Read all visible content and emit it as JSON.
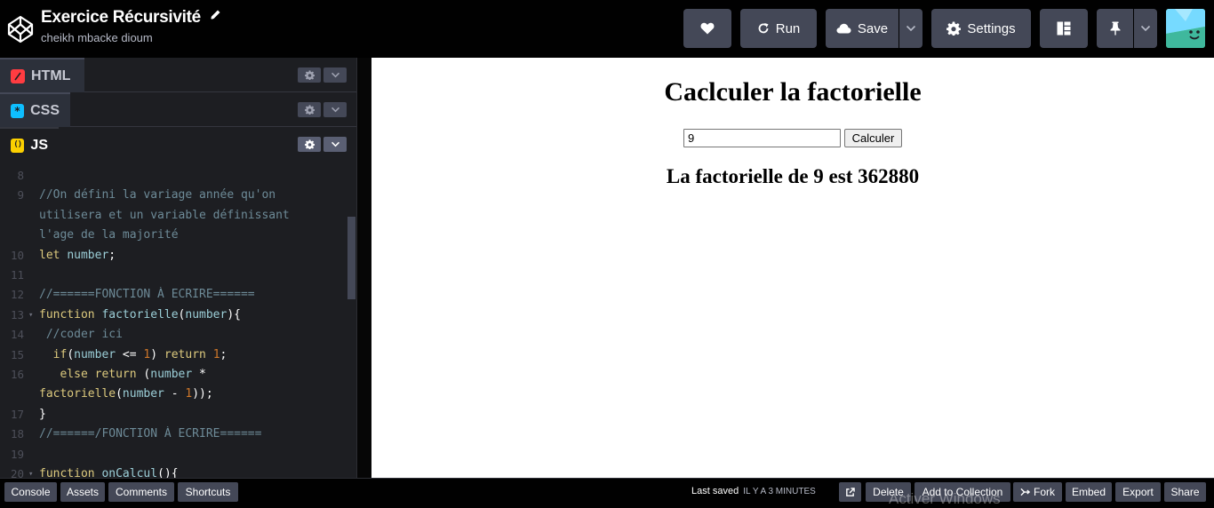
{
  "header": {
    "title": "Exercice Récursivité",
    "author": "cheikh mbacke dioum",
    "buttons": {
      "run": "Run",
      "save": "Save",
      "settings": "Settings"
    }
  },
  "editor": {
    "tabs": [
      {
        "label": "HTML",
        "icon_char": "/",
        "icon_color": "#ff3c41"
      },
      {
        "label": "CSS",
        "icon_char": "*",
        "icon_color": "#0ebeff"
      },
      {
        "label": "JS",
        "icon_char": "()",
        "icon_color": "#fcd000"
      }
    ],
    "code_lines": [
      {
        "num": "8",
        "fold": false,
        "tokens": []
      },
      {
        "num": "9",
        "fold": false,
        "tokens": [
          {
            "t": "//On défini la variage année qu'on",
            "c": "c-com"
          }
        ]
      },
      {
        "num": "",
        "fold": false,
        "tokens": [
          {
            "t": "utilisera et un variable définissant",
            "c": "c-com"
          }
        ]
      },
      {
        "num": "",
        "fold": false,
        "tokens": [
          {
            "t": "l'age de la majorité",
            "c": "c-com"
          }
        ]
      },
      {
        "num": "10",
        "fold": false,
        "tokens": [
          {
            "t": "let",
            "c": "c-kw"
          },
          {
            "t": " ",
            "c": "c-op"
          },
          {
            "t": "number",
            "c": "c-var"
          },
          {
            "t": ";",
            "c": "c-op"
          }
        ]
      },
      {
        "num": "11",
        "fold": false,
        "tokens": []
      },
      {
        "num": "12",
        "fold": false,
        "tokens": [
          {
            "t": "//======FONCTION À ECRIRE======",
            "c": "c-com"
          }
        ]
      },
      {
        "num": "13",
        "fold": true,
        "tokens": [
          {
            "t": "function",
            "c": "c-kw"
          },
          {
            "t": " ",
            "c": "c-op"
          },
          {
            "t": "factorielle",
            "c": "c-var"
          },
          {
            "t": "(",
            "c": "c-op"
          },
          {
            "t": "number",
            "c": "c-var"
          },
          {
            "t": "){",
            "c": "c-op"
          }
        ]
      },
      {
        "num": "14",
        "fold": false,
        "tokens": [
          {
            "t": " //coder ici",
            "c": "c-com"
          }
        ]
      },
      {
        "num": "15",
        "fold": false,
        "tokens": [
          {
            "t": "  ",
            "c": "c-op"
          },
          {
            "t": "if",
            "c": "c-kw"
          },
          {
            "t": "(",
            "c": "c-op"
          },
          {
            "t": "number",
            "c": "c-var"
          },
          {
            "t": " <= ",
            "c": "c-op"
          },
          {
            "t": "1",
            "c": "c-num"
          },
          {
            "t": ") ",
            "c": "c-op"
          },
          {
            "t": "return",
            "c": "c-kw"
          },
          {
            "t": " ",
            "c": "c-op"
          },
          {
            "t": "1",
            "c": "c-num"
          },
          {
            "t": ";",
            "c": "c-op"
          }
        ]
      },
      {
        "num": "16",
        "fold": false,
        "tokens": [
          {
            "t": "   ",
            "c": "c-op"
          },
          {
            "t": "else",
            "c": "c-kw"
          },
          {
            "t": " ",
            "c": "c-op"
          },
          {
            "t": "return",
            "c": "c-kw"
          },
          {
            "t": " (",
            "c": "c-op"
          },
          {
            "t": "number",
            "c": "c-var"
          },
          {
            "t": " *",
            "c": "c-op"
          }
        ]
      },
      {
        "num": "",
        "fold": false,
        "tokens": [
          {
            "t": "factorielle",
            "c": "c-fn"
          },
          {
            "t": "(",
            "c": "c-op"
          },
          {
            "t": "number",
            "c": "c-var"
          },
          {
            "t": " - ",
            "c": "c-op"
          },
          {
            "t": "1",
            "c": "c-num"
          },
          {
            "t": "));",
            "c": "c-op"
          }
        ]
      },
      {
        "num": "17",
        "fold": false,
        "tokens": [
          {
            "t": "}",
            "c": "c-op"
          }
        ]
      },
      {
        "num": "18",
        "fold": false,
        "tokens": [
          {
            "t": "//======/FONCTION À ECRIRE======",
            "c": "c-com"
          }
        ]
      },
      {
        "num": "19",
        "fold": false,
        "tokens": []
      },
      {
        "num": "20",
        "fold": true,
        "tokens": [
          {
            "t": "function",
            "c": "c-kw"
          },
          {
            "t": " ",
            "c": "c-op"
          },
          {
            "t": "onCalcul",
            "c": "c-var"
          },
          {
            "t": "(){",
            "c": "c-op"
          }
        ]
      }
    ]
  },
  "preview": {
    "heading": "Caclculer la factorielle",
    "input_value": "9",
    "button_label": "Calculer",
    "result": "La factorielle de 9 est 362880"
  },
  "footer": {
    "console": "Console",
    "assets": "Assets",
    "comments": "Comments",
    "shortcuts": "Shortcuts",
    "last_saved_label": "Last saved",
    "last_saved_when": "IL Y A 3 MINUTES",
    "delete": "Delete",
    "add_to_collection": "Add to Collection",
    "fork": "Fork",
    "embed": "Embed",
    "export": "Export",
    "share": "Share",
    "watermark": "Activer Windows"
  }
}
